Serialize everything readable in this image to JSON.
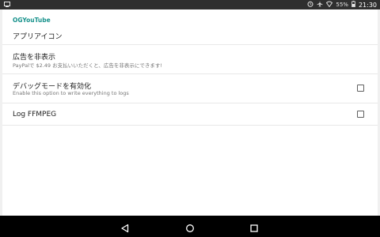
{
  "status_bar": {
    "battery": "55%",
    "time": "21:30",
    "icons": [
      "screenshot-icon",
      "alarm-icon",
      "airplane-mode-icon",
      "wifi-icon",
      "battery-icon"
    ]
  },
  "category": {
    "title": "OGYouTube",
    "accent_color": "#18928c"
  },
  "preferences": [
    {
      "title": "アプリアイコン",
      "summary": ""
    },
    {
      "title": "広告を非表示",
      "summary": "PayPalで $2.49 お支払いいただくと、広告を非表示にできます!"
    },
    {
      "title": "デバッグモードを有効化",
      "summary": "Enable this option to write everything to logs",
      "checked": false
    },
    {
      "title": "Log FFMPEG",
      "summary": "",
      "checked": false
    }
  ],
  "nav_bar": {
    "icons": [
      "back-icon",
      "home-icon",
      "recents-icon"
    ]
  }
}
